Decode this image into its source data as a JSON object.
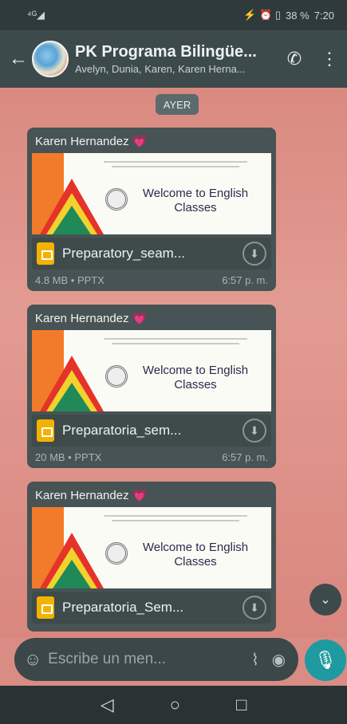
{
  "status_bar": {
    "signal": "⁴ᴳ◢",
    "icons": "⚡ ⏰ ▯",
    "battery": "38 %",
    "time": "7:20"
  },
  "header": {
    "back_icon": "back-arrow-icon",
    "title": "PK Programa Bilingüe...",
    "subtitle": "Avelyn, Dunia, Karen, Karen Herna...",
    "call_icon": "add-call-icon",
    "menu_icon": "more-vert-icon"
  },
  "date_label": "AYER",
  "messages": [
    {
      "sender": "Karen Hernandez",
      "heart": "💗",
      "preview_title": "Welcome to English Classes",
      "file_name": "Preparatory_seam...",
      "size_type": "4.8 MB • PPTX",
      "time": "6:57 p. m."
    },
    {
      "sender": "Karen Hernandez",
      "heart": "💗",
      "preview_title": "Welcome to English Classes",
      "file_name": "Preparatoria_sem...",
      "size_type": "20 MB • PPTX",
      "time": "6:57 p. m."
    },
    {
      "sender": "Karen Hernandez",
      "heart": "💗",
      "preview_title": "Welcome to English Classes",
      "file_name": "Preparatoria_Sem...",
      "size_type": "",
      "time": ""
    }
  ],
  "input": {
    "placeholder": "Escribe un men..."
  }
}
